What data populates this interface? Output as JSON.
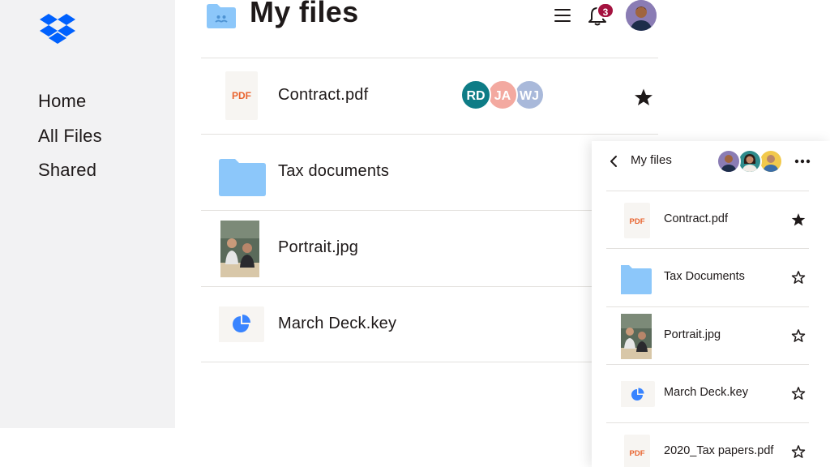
{
  "sidebar": {
    "logo": "dropbox-logo",
    "items": [
      {
        "label": "Home"
      },
      {
        "label": "All Files"
      },
      {
        "label": "Shared"
      }
    ]
  },
  "header": {
    "folder_icon": "shared-folder-icon",
    "title": "My files",
    "menu_icon": "hamburger-menu-icon",
    "notification_icon": "bell-icon",
    "notification_count": "3",
    "avatar": "user-avatar"
  },
  "files": [
    {
      "name": "Contract.pdf",
      "type_label": "PDF",
      "icon": "pdf-file-icon",
      "starred": true,
      "collaborators": [
        {
          "initials": "RD",
          "color": "#0e7c86"
        },
        {
          "initials": "JA",
          "color": "#f3a9a0"
        },
        {
          "initials": "WJ",
          "color": "#a9b9da"
        }
      ]
    },
    {
      "name": "Tax documents",
      "icon": "folder-icon"
    },
    {
      "name": "Portrait.jpg",
      "icon": "image-thumbnail"
    },
    {
      "name": "March Deck.key",
      "icon": "keynote-pie-chart-icon"
    }
  ],
  "panel": {
    "back_icon": "chevron-left-icon",
    "title": "My files",
    "more_icon": "more-horizontal-icon",
    "members": [
      "member-avatar-1",
      "member-avatar-2",
      "member-avatar-3"
    ],
    "items": [
      {
        "name": "Contract.pdf",
        "type_label": "PDF",
        "icon": "pdf-file-icon",
        "starred": true
      },
      {
        "name": "Tax Documents",
        "icon": "folder-icon",
        "starred": false
      },
      {
        "name": "Portrait.jpg",
        "icon": "image-thumbnail",
        "starred": false
      },
      {
        "name": "March Deck.key",
        "icon": "keynote-pie-chart-icon",
        "starred": false
      },
      {
        "name": "2020_Tax papers.pdf",
        "type_label": "PDF",
        "icon": "pdf-file-icon",
        "starred": false
      }
    ]
  },
  "colors": {
    "brand": "#0061fe",
    "folder": "#8cc7fa",
    "pdf_label": "#e9642f",
    "badge": "#a4123f",
    "sidebar_bg": "#f2f2f3"
  }
}
